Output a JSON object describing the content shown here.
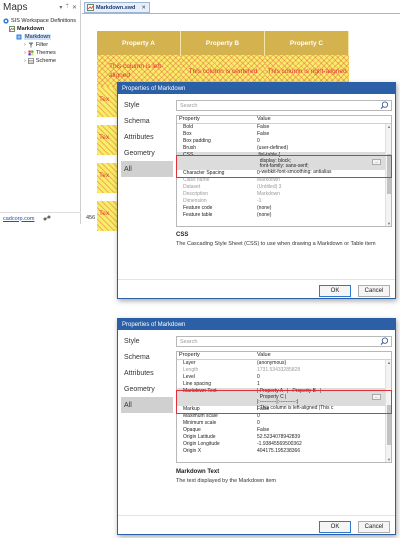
{
  "maps": {
    "title": "Maps",
    "pin_glyph": "▾",
    "pin2_glyph": "ᛘ",
    "close_glyph": "✕",
    "tree": [
      {
        "label": "SIS Workspace Definitions",
        "icon": "workspace-icon",
        "bold": false
      },
      {
        "label": "Markdown",
        "icon": "map-icon",
        "bold": true
      },
      {
        "label": "Markdown",
        "icon": "overlay-icon",
        "bold": false,
        "selected": true
      },
      {
        "label": "Filter",
        "icon": "filter-icon",
        "bold": false
      },
      {
        "label": "Themes",
        "icon": "themes-icon",
        "bold": false
      },
      {
        "label": "Scheme",
        "icon": "scheme-icon",
        "bold": false
      }
    ],
    "footer_link": "cadcorp.com",
    "scroll_number": "456"
  },
  "document": {
    "tab_label": "Markdown.swd",
    "tab_close": "✕",
    "table": {
      "headers": [
        "Property A",
        "Property B",
        "Property C"
      ],
      "row": [
        "This column is left-aligned",
        "This column is centered",
        "This column is right-aligned"
      ],
      "stripe_cells": [
        "Tex",
        "Tex",
        "Tex",
        "Tex"
      ]
    }
  },
  "dialog_top": {
    "title": "Properties of Markdown",
    "nav": [
      "Style",
      "Schema",
      "Attributes",
      "Geometry",
      "All"
    ],
    "selected_nav": "All",
    "search_placeholder": "Search",
    "col_property": "Property",
    "col_value": "Value",
    "rows": [
      {
        "p": "Bold",
        "v": "False"
      },
      {
        "p": "Box",
        "v": "False"
      },
      {
        "p": "Box padding",
        "v": "0"
      },
      {
        "p": "Brush",
        "v": "(user-defined)"
      },
      {
        "p": "CSS",
        "v": ".fixl-table {\n  display: block;\n  font-family: sans-serif;\n  -webkit-font-smoothing: antialias",
        "highlight": true
      },
      {
        "p": "Character Spacing",
        "v": "0"
      },
      {
        "p": "Class name",
        "v": "Markdown",
        "dim": true
      },
      {
        "p": "Dataset",
        "v": "(Untitled) 3",
        "dim": true
      },
      {
        "p": "Description",
        "v": "Markdown",
        "dim": true
      },
      {
        "p": "Dimension",
        "v": "-1",
        "dim": true
      },
      {
        "p": "Feature code",
        "v": "(none)"
      },
      {
        "p": "Feature table",
        "v": "(none)"
      }
    ],
    "desc_title": "CSS",
    "desc_text": "The Cascading Style Sheet (CSS) to use when drawing a Markdown or Table item",
    "ok": "OK",
    "cancel": "Cancel"
  },
  "dialog_bottom": {
    "title": "Properties of Markdown",
    "nav": [
      "Style",
      "Schema",
      "Attributes",
      "Geometry",
      "All"
    ],
    "selected_nav": "All",
    "search_placeholder": "Search",
    "col_property": "Property",
    "col_value": "Value",
    "rows": [
      {
        "p": "Layer",
        "v": "(anonymous)"
      },
      {
        "p": "Length",
        "v": "1731.53433285828",
        "dim": true
      },
      {
        "p": "Level",
        "v": "0"
      },
      {
        "p": "Line spacing",
        "v": "1"
      },
      {
        "p": "Markdown Text",
        "v": "| Property A   |   Property B   |\n  Property C |\n|:----------|:----------:|\n| This column is left-aligned |This c",
        "highlight": true
      },
      {
        "p": "Markup",
        "v": "False"
      },
      {
        "p": "Maximum scale",
        "v": "0"
      },
      {
        "p": "Minimum scale",
        "v": "0"
      },
      {
        "p": "Opaque",
        "v": "False"
      },
      {
        "p": "Origin Latitude",
        "v": "52.5234078942839"
      },
      {
        "p": "Origin Longitude",
        "v": "-1.93845569500362"
      },
      {
        "p": "Origin X",
        "v": "404175.195238366"
      }
    ],
    "desc_title": "Markdown Text",
    "desc_text": "The text displayed by the Markdown item",
    "ok": "OK",
    "cancel": "Cancel"
  }
}
